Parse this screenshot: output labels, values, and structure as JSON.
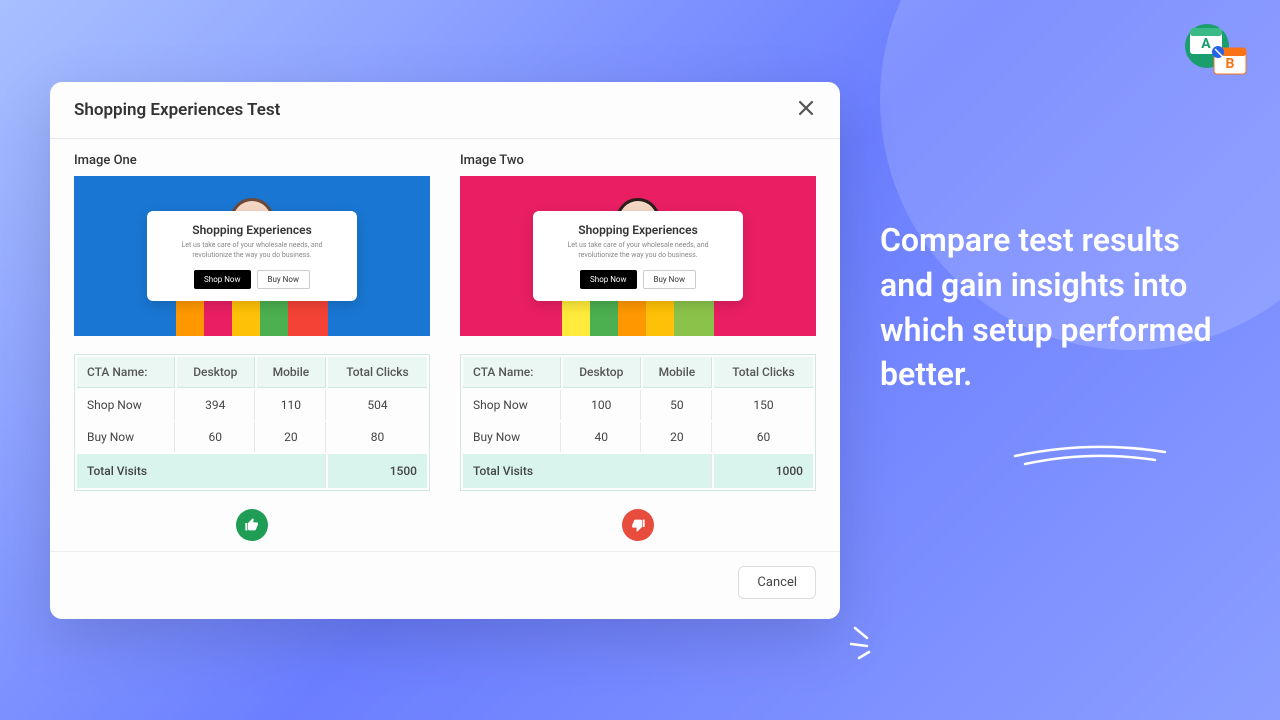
{
  "modal": {
    "title": "Shopping Experiences Test",
    "cancel_label": "Cancel"
  },
  "headline": "Compare test results and gain insights into which setup performed better.",
  "table_headers": {
    "cta": "CTA Name:",
    "desktop": "Desktop",
    "mobile": "Mobile",
    "total": "Total Clicks",
    "visits": "Total Visits"
  },
  "hero_card": {
    "title": "Shopping Experiences",
    "subtitle": "Let us take care of your wholesale needs, and revolutionize the way you do business.",
    "shop_label": "Shop Now",
    "buy_label": "Buy Now"
  },
  "variants": {
    "a": {
      "label": "Image One",
      "rows": [
        {
          "name": "Shop Now",
          "desktop": "394",
          "mobile": "110",
          "total": "504"
        },
        {
          "name": "Buy Now",
          "desktop": "60",
          "mobile": "20",
          "total": "80"
        }
      ],
      "visits": "1500",
      "verdict": "up",
      "bg_color": "#1976d2"
    },
    "b": {
      "label": "Image Two",
      "rows": [
        {
          "name": "Shop Now",
          "desktop": "100",
          "mobile": "50",
          "total": "150"
        },
        {
          "name": "Buy Now",
          "desktop": "40",
          "mobile": "20",
          "total": "60"
        }
      ],
      "visits": "1000",
      "verdict": "down",
      "bg_color": "#e91e63"
    }
  }
}
